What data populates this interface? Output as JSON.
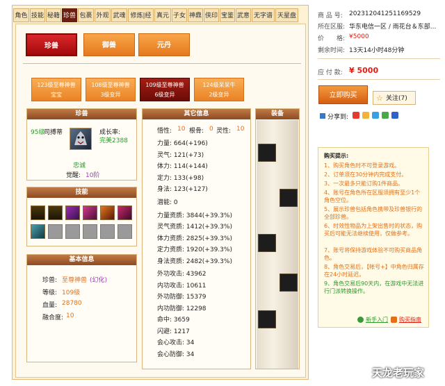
{
  "tabs": [
    "角色",
    "技能",
    "秘籍",
    "珍兽",
    "包裹",
    "外观",
    "武魂",
    "修炼|经脉",
    "真元",
    "子女",
    "神鼎",
    "侠印",
    "宝鉴",
    "武意",
    "无字谱",
    "天星盘"
  ],
  "active_tab": 3,
  "categories": [
    "珍兽",
    "御兽",
    "元丹"
  ],
  "pet_tabs": [
    {
      "line1": "123级至尊神兽",
      "line2": "宝宝"
    },
    {
      "line1": "108级至尊神兽",
      "line2": "3级变异"
    },
    {
      "line1": "109级至尊神兽",
      "line2": "6级变异"
    },
    {
      "line1": "124级呆呆牛",
      "line2": "2级变异"
    }
  ],
  "pet_panel": {
    "header": "珍兽",
    "level": "95级",
    "name": "司搏蒂",
    "growth_label": "成长率:",
    "growth_value": "完美2388",
    "personality": "忠诚",
    "awaken_label": "觉醒:",
    "awaken_value": "10阶"
  },
  "skills_panel": {
    "header": "技能"
  },
  "basic_panel": {
    "header": "基本信息",
    "species_label": "珍兽:",
    "species_value": "至尊神兽",
    "species_extra": "(幻化)",
    "level_label": "等级:",
    "level_value": "109级",
    "hp_label": "血量:",
    "hp_value": "28780",
    "fusion_label": "融合度:",
    "fusion_value": "10"
  },
  "other_panel": {
    "header": "其它信息",
    "top": {
      "l1": "悟性:",
      "v1": "10",
      "l2": "根骨:",
      "v2": "0",
      "l3": "灵性:",
      "v3": "10"
    },
    "stats": [
      "力量: 664(+196)",
      "灵气: 121(+73)",
      "体力: 114(+144)",
      "定力: 133(+98)",
      "身法: 123(+127)"
    ],
    "potential": "潜能: 0",
    "aptitudes": [
      "力量资质: 3844(+39.3%)",
      "灵气资质: 1412(+39.3%)",
      "体力资质: 2825(+39.3%)",
      "定力资质: 1920(+39.3%)",
      "身法资质: 2482(+39.3%)"
    ],
    "combat": [
      "外功攻击: 43962",
      "内功攻击: 10611",
      "外功防御: 15379",
      "内功防御: 12298",
      "命中: 3659",
      "闪避: 1217",
      "会心攻击: 34",
      "会心防御: 34"
    ]
  },
  "equip_panel": {
    "header": "装备"
  },
  "info": {
    "product_label": "商 品 号:",
    "product_value": "202312041251169529",
    "region_label": "所在区服:",
    "region_value": "华东电信一区 / 雨花台＆东部...",
    "price_label": "价　　格:",
    "price_value": "¥5000",
    "time_label": "剩余时间:",
    "time_value": "13天14小时48分钟",
    "due_label": "应 付 款:",
    "due_value": "¥ 5000",
    "buy_label": "立即购买",
    "follow_label": "关注(7)",
    "share_label": "分享到:"
  },
  "tips": {
    "title": "购买提示:",
    "items": [
      "1、购买角色时不可登录游戏。",
      "2、订单须在30分钟内完成支付。",
      "3、一次最多只能订购1件商品。",
      "4、账号在角色所在区服须拥有至少1个角色空位。",
      "5、展示珍兽包括角色携带及珍兽银行的全部珍兽。",
      "6、时效性物品为上架出售时的状态，购买后可能无法继续使用，仅做参考。",
      "7、账号将保持游戏体验不可购买商品角色。",
      "8、角色交易后，【帐号+】中角色归属存在24小时延迟。",
      "9、角色交易后90天内，在游戏中无法进行门派转换操作。"
    ],
    "newbie": "新手入门",
    "flow": "购买指南"
  },
  "watermark": "天龙老玩家",
  "colors": {
    "accent": "#e46f15",
    "price": "#e31b12",
    "tab_active": "#6b1f10",
    "header": "#8e4b23"
  }
}
